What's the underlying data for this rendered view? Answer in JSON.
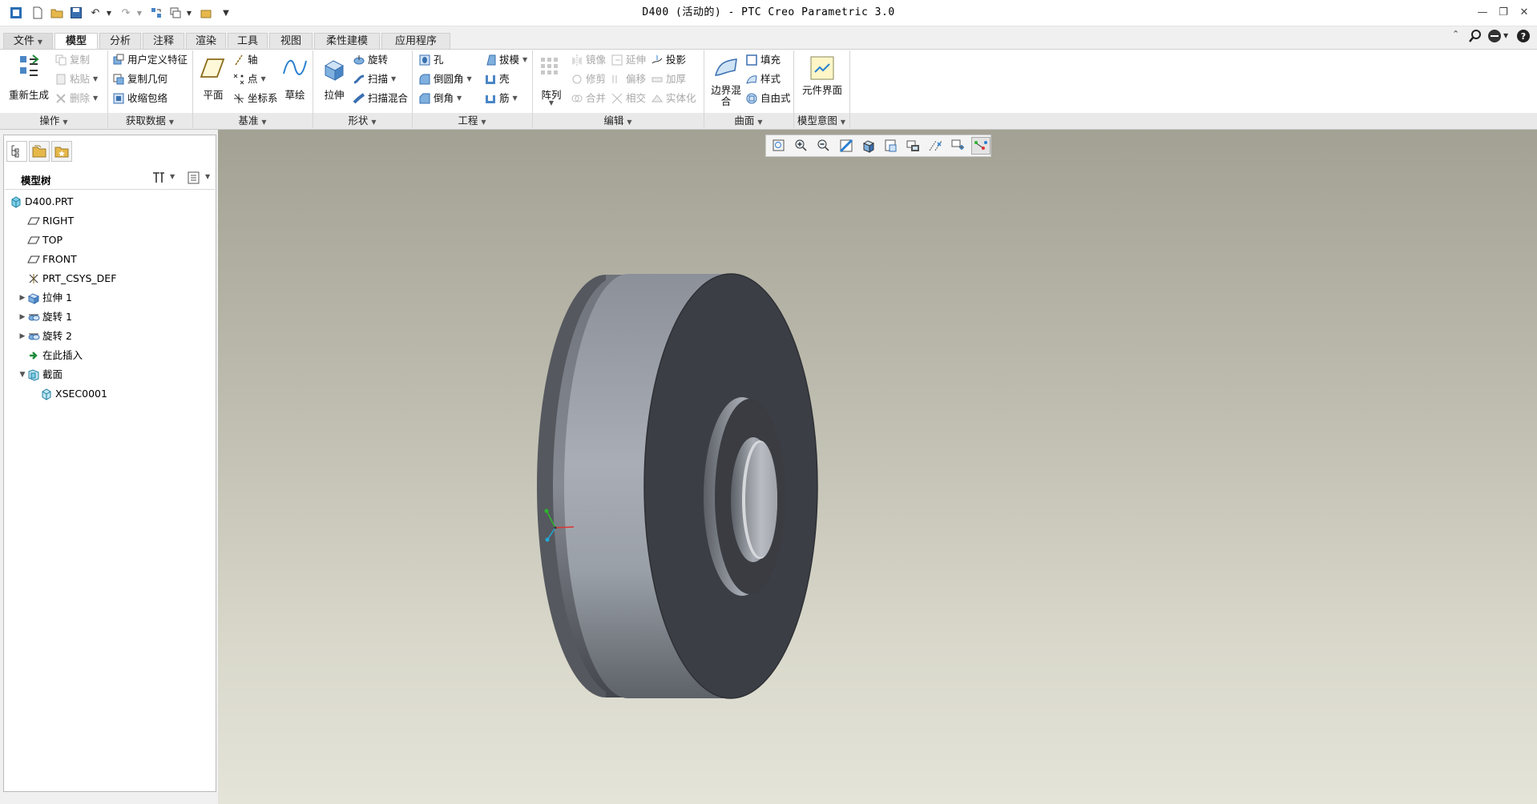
{
  "window": {
    "title": "D400 (活动的) - PTC Creo Parametric 3.0"
  },
  "tabs": [
    {
      "label": "文件",
      "file": true
    },
    {
      "label": "模型",
      "active": true
    },
    {
      "label": "分析"
    },
    {
      "label": "注释"
    },
    {
      "label": "渲染"
    },
    {
      "label": "工具"
    },
    {
      "label": "视图"
    },
    {
      "label": "柔性建模"
    },
    {
      "label": "应用程序"
    }
  ],
  "ribbon": {
    "operations": {
      "regenerate": "重新生成",
      "copy": "复制",
      "paste": "粘贴",
      "delete": "删除",
      "group_label": "操作"
    },
    "get_data": {
      "udf": "用户定义特征",
      "copy_geom": "复制几何",
      "shrinkwrap": "收缩包络",
      "group_label": "获取数据"
    },
    "datum": {
      "plane": "平面",
      "axis": "轴",
      "point": "点",
      "csys": "坐标系",
      "sketch": "草绘",
      "group_label": "基准"
    },
    "shapes": {
      "extrude": "拉伸",
      "revolve": "旋转",
      "sweep": "扫描",
      "swept_blend": "扫描混合",
      "group_label": "形状"
    },
    "engineering": {
      "hole": "孔",
      "draft": "拔模",
      "round": "倒圆角",
      "shell": "壳",
      "chamfer": "倒角",
      "rib": "筋",
      "group_label": "工程"
    },
    "editing": {
      "pattern": "阵列",
      "mirror": "镜像",
      "extend": "延伸",
      "project": "投影",
      "trim": "修剪",
      "offset": "偏移",
      "thicken": "加厚",
      "merge": "合并",
      "intersect": "相交",
      "solidify": "实体化",
      "group_label": "编辑"
    },
    "surfaces": {
      "boundary_blend": "边界混合",
      "fill": "填充",
      "style": "样式",
      "freestyle": "自由式",
      "group_label": "曲面"
    },
    "model_intent": {
      "component_interface": "元件界面",
      "group_label": "模型意图"
    }
  },
  "model_tree": {
    "header": "模型树",
    "nodes": [
      {
        "label": "D400.PRT",
        "icon": "part-icon",
        "indent": 0,
        "expand": ""
      },
      {
        "label": "RIGHT",
        "icon": "datum-plane-icon",
        "indent": 1,
        "expand": ""
      },
      {
        "label": "TOP",
        "icon": "datum-plane-icon",
        "indent": 1,
        "expand": ""
      },
      {
        "label": "FRONT",
        "icon": "datum-plane-icon",
        "indent": 1,
        "expand": ""
      },
      {
        "label": "PRT_CSYS_DEF",
        "icon": "csys-icon",
        "indent": 1,
        "expand": ""
      },
      {
        "label": "拉伸 1",
        "icon": "extrude-icon",
        "indent": 1,
        "expand": "collapsed"
      },
      {
        "label": "旋转 1",
        "icon": "revolve-icon",
        "indent": 1,
        "expand": "collapsed"
      },
      {
        "label": "旋转 2",
        "icon": "revolve-icon",
        "indent": 1,
        "expand": "collapsed"
      },
      {
        "label": "在此插入",
        "icon": "insert-here-icon",
        "indent": 1,
        "expand": ""
      },
      {
        "label": "截面",
        "icon": "section-folder-icon",
        "indent": 1,
        "expand": "expanded"
      },
      {
        "label": "XSEC0001",
        "icon": "xsec-icon",
        "indent": 2,
        "expand": ""
      }
    ]
  },
  "colors": {
    "accent": "#2a7fcf",
    "model_dark": "#3c3e45",
    "model_light": "#a9adb5"
  }
}
